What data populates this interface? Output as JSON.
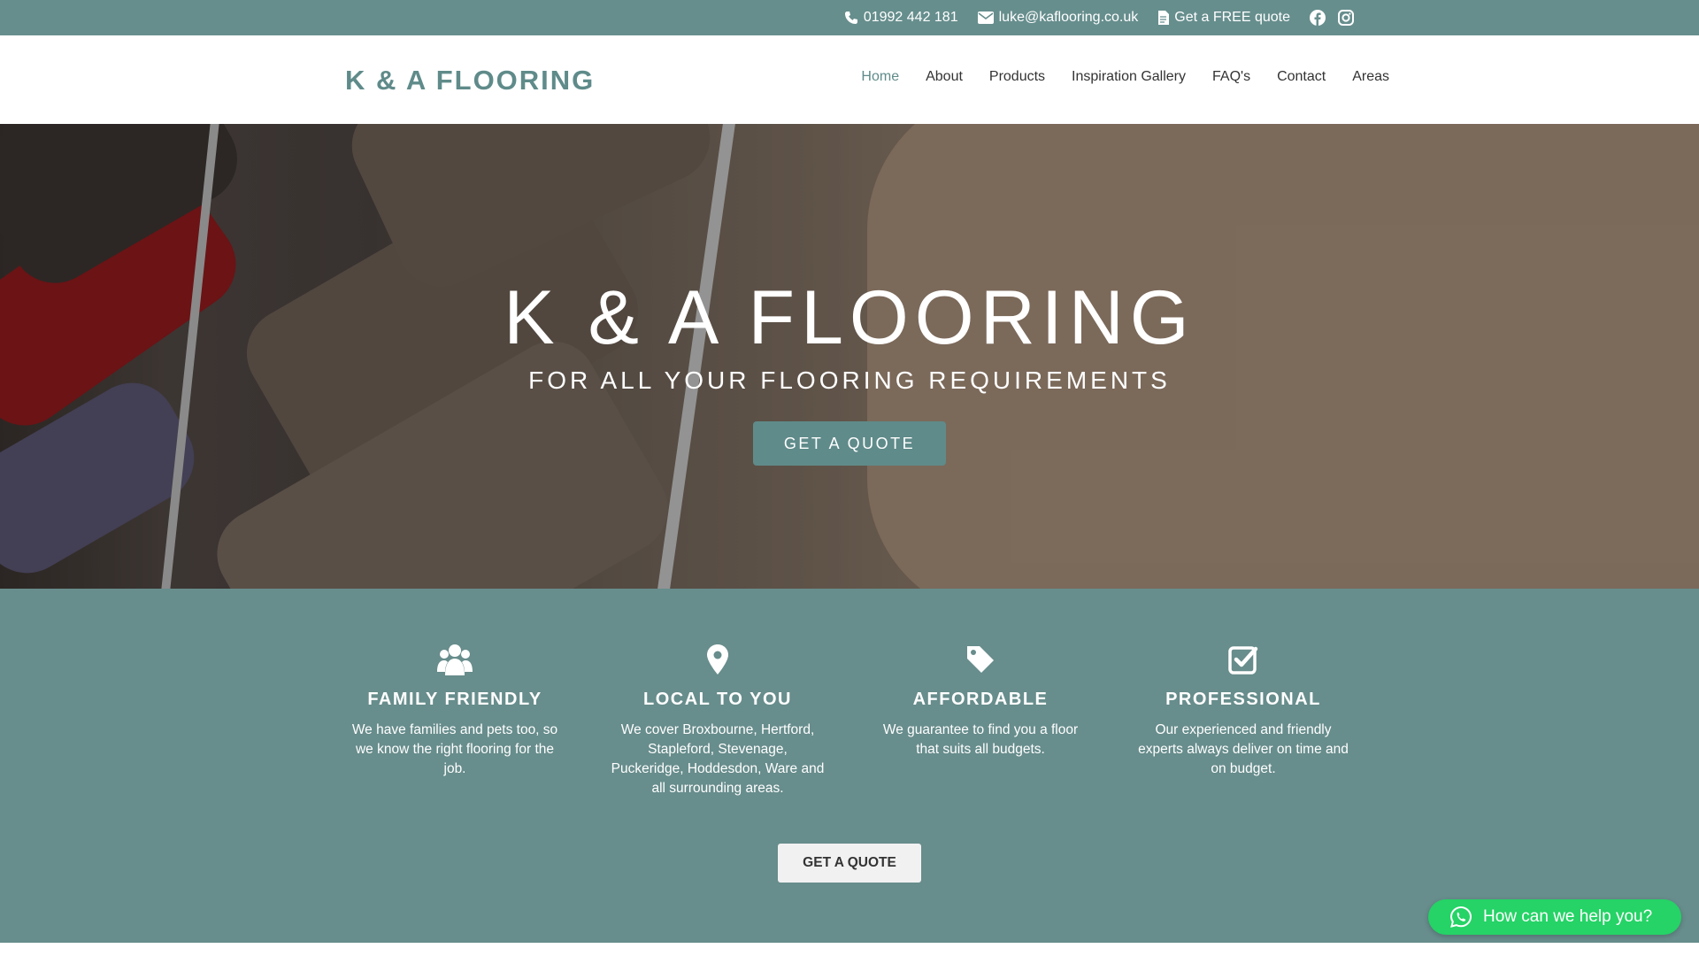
{
  "topbar": {
    "phone": "01992 442 181",
    "email": "luke@kaflooring.co.uk",
    "quote": "Get a FREE quote",
    "social": [
      "facebook-icon",
      "instagram-icon"
    ]
  },
  "header": {
    "logo": "K & A FLOORING",
    "nav": [
      "Home",
      "About",
      "Products",
      "Inspiration Gallery",
      "FAQ's",
      "Contact",
      "Areas"
    ],
    "active": "Home"
  },
  "hero": {
    "title": "K & A FLOORING",
    "subtitle": "FOR ALL YOUR FLOORING REQUIREMENTS",
    "button": "GET A QUOTE"
  },
  "features": [
    {
      "icon": "users-icon",
      "title": "FAMILY FRIENDLY",
      "text": "We have families and pets too, so we know the right flooring for the job."
    },
    {
      "icon": "map-pin-icon",
      "title": "LOCAL TO YOU",
      "text": "We cover Broxbourne, Hertford, Stapleford, Stevenage, Puckeridge, Hoddesdon, Ware and all surrounding areas."
    },
    {
      "icon": "tag-icon",
      "title": "AFFORDABLE",
      "text": "We guarantee to find you a floor that suits all budgets."
    },
    {
      "icon": "check-square-icon",
      "title": "PROFESSIONAL",
      "text": "Our experienced and friendly experts always deliver on time and on budget."
    }
  ],
  "features_button": "GET A QUOTE",
  "whatsapp": {
    "label": "How can we help you?",
    "icon": "whatsapp-icon"
  },
  "colors": {
    "brand": "#668e8d",
    "whatsapp": "#25d366"
  }
}
